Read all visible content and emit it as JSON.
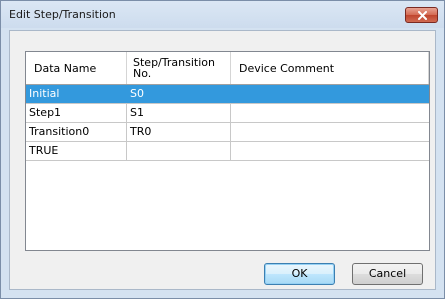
{
  "window": {
    "title": "Edit Step/Transition"
  },
  "grid": {
    "headers": [
      "Data Name",
      "Step/Transition\nNo.",
      "Device Comment"
    ],
    "rows": [
      {
        "data_name": "Initial",
        "step_no": "S0",
        "comment": "",
        "selected": true
      },
      {
        "data_name": "Step1",
        "step_no": "S1",
        "comment": ""
      },
      {
        "data_name": "Transition0",
        "step_no": "TR0",
        "comment": ""
      },
      {
        "data_name": "TRUE",
        "step_no": "",
        "comment": ""
      }
    ]
  },
  "buttons": {
    "ok": "OK",
    "cancel": "Cancel"
  },
  "colors": {
    "selection": "#3399dd",
    "close_button": "#c0442d"
  }
}
